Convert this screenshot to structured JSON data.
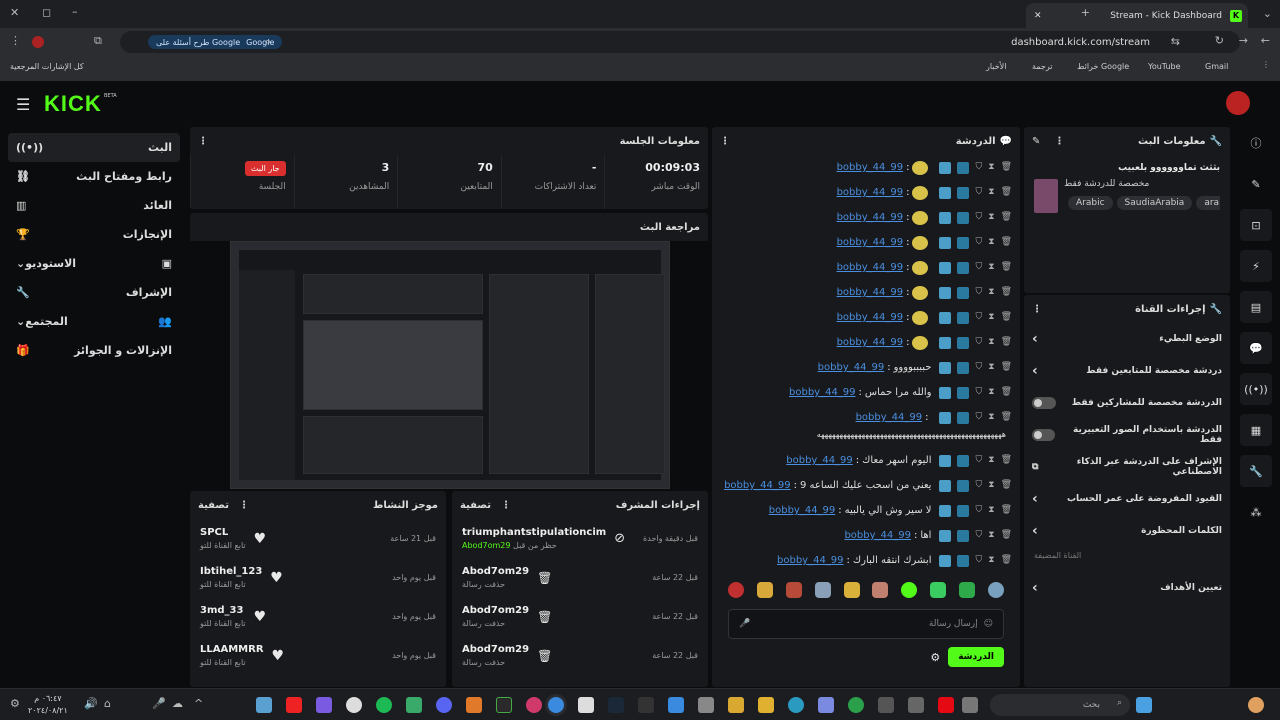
{
  "browser": {
    "tab_title": "Stream - Kick Dashboard",
    "tab_favicon": "K",
    "url": "dashboard.kick.com/stream",
    "google_pill": "طرح أسئلة على Google",
    "bookmarks": [
      "Gmail",
      "YouTube",
      "خرائط Google",
      "ترجمة",
      "الأخبار"
    ],
    "all_bookmarks": "كل الإشارات المرجعية"
  },
  "app": {
    "logo": "KICK",
    "logo_sup": "BETA",
    "accent": "#53fc18",
    "nav": [
      {
        "label": "البث",
        "icon": "broadcast-icon",
        "active": true
      },
      {
        "label": "رابط ومفتاح البث",
        "icon": "link-icon"
      },
      {
        "label": "العائد",
        "icon": "chart-icon"
      },
      {
        "label": "الإنجازات",
        "icon": "trophy-icon"
      },
      {
        "label": "الاستوديو",
        "icon": "studio-icon",
        "chevron": true
      },
      {
        "label": "الإشراف",
        "icon": "wrench-icon"
      },
      {
        "label": "المجتمع",
        "icon": "users-icon",
        "chevron": true
      },
      {
        "label": "الإنزالات و الجوائز",
        "icon": "gift-icon"
      }
    ]
  },
  "session": {
    "title": "معلومات الجلسة",
    "stats": [
      {
        "value": "00:09:03",
        "label": "الوقت مباشر"
      },
      {
        "value": "-",
        "label": "تعداد الاشتراكات"
      },
      {
        "value": "70",
        "label": "المتابعين"
      },
      {
        "value": "3",
        "label": "المشاهدين"
      },
      {
        "value": "جار البث",
        "label": "الجلسة"
      }
    ]
  },
  "preview": {
    "title": "مراجعة البث"
  },
  "activity": {
    "title": "موجز النشاط",
    "filter": "تصفية",
    "items": [
      {
        "name": "SPCL",
        "sub": "تابع القناة للتو",
        "when": "قبل 21 ساعة"
      },
      {
        "name": "Ibtihel_123",
        "sub": "تابع القناة للتو",
        "when": "قبل يوم واحد"
      },
      {
        "name": "3md_33",
        "sub": "تابع القناة للتو",
        "when": "قبل يوم واحد"
      },
      {
        "name": "LLAAMMRR",
        "sub": "تابع القناة للتو",
        "when": "قبل يوم واحد"
      }
    ]
  },
  "modactions": {
    "title": "إجراءات المشرف",
    "filter": "تصفية",
    "items": [
      {
        "name": "triumphantstipulationcim",
        "sub": "حظر من قبل",
        "by": "Abod7om29",
        "when": "قبل دقيقة واحدة",
        "icon": "ban-icon"
      },
      {
        "name": "Abod7om29",
        "sub": "حذفت رسالة",
        "when": "قبل 22 ساعة",
        "icon": "trash-icon"
      },
      {
        "name": "Abod7om29",
        "sub": "حذفت رسالة",
        "when": "قبل 22 ساعة",
        "icon": "trash-icon"
      },
      {
        "name": "Abod7om29",
        "sub": "حذفت رسالة",
        "when": "قبل 22 ساعة",
        "icon": "trash-icon"
      }
    ]
  },
  "chat": {
    "title": "الدردشة",
    "rows": [
      {
        "user": "bobby_44_99",
        "msg": "",
        "emoji": true
      },
      {
        "user": "bobby_44_99",
        "msg": "",
        "emoji": true
      },
      {
        "user": "bobby_44_99",
        "msg": "",
        "emoji": true
      },
      {
        "user": "bobby_44_99",
        "msg": "",
        "emoji": true
      },
      {
        "user": "bobby_44_99",
        "msg": "",
        "emoji": true
      },
      {
        "user": "bobby_44_99",
        "msg": "",
        "emoji": true
      },
      {
        "user": "bobby_44_99",
        "msg": "",
        "emoji": true
      },
      {
        "user": "bobby_44_99",
        "msg": "",
        "emoji": true
      },
      {
        "user": "bobby_44_99",
        "msg": "حببببوووو",
        "emoji": false
      },
      {
        "user": "bobby_44_99",
        "msg": "والله مرا حماس",
        "emoji": false
      },
      {
        "user": "bobby_44_99",
        "msg": "",
        "emoji": false
      }
    ],
    "long_line": "ههههههههههههههههههههههههههههههههههههههههههههههههههه",
    "rows2": [
      {
        "user": "bobby_44_99",
        "msg": "اليوم اسهر معاك"
      },
      {
        "user": "bobby_44_99",
        "msg": "يعني من اسحب عليك الساعه 9"
      },
      {
        "user": "bobby_44_99",
        "msg": "لا سير وش الي يالبيه"
      },
      {
        "user": "bobby_44_99",
        "msg": "اها"
      },
      {
        "user": "bobby_44_99",
        "msg": "ابشرك انتقه البارك"
      }
    ],
    "placeholder": "إرسال رسالة",
    "send": "الدردشة"
  },
  "streaminfo": {
    "title": "معلومات البث",
    "stream_title": "بثثث تماوووووو بلعبيب",
    "category": "مخصصة للدردشة فقط",
    "tags": [
      "Arabic",
      "SaudiaArabia",
      "ara"
    ]
  },
  "channel_actions": {
    "title": "إجراءات القناة",
    "rows": [
      {
        "label": "الوضع البطيء",
        "kind": "chevron"
      },
      {
        "label": "دردشة مخصصة للمتابعين فقط",
        "kind": "chevron"
      },
      {
        "label": "الدردشة مخصصة للمشاركين فقط",
        "kind": "toggle"
      },
      {
        "label": "الدردشة باستخدام الصور التعبيرية فقط",
        "kind": "toggle"
      },
      {
        "label": "الإشراف على الدردشة عبر الذكاء الاصطناعي",
        "kind": "external"
      },
      {
        "label": "القيود المفروضة على عمر الحساب",
        "kind": "chevron"
      },
      {
        "label": "الكلمات المحظورة",
        "kind": "chevron"
      }
    ],
    "section": "القناة المضيفة",
    "goals": "تعيين الأهداف"
  },
  "taskbar": {
    "search": "بحث",
    "time": "٠٦:٤٧ م",
    "date": "٢٠٢٤/٠٨/٢١"
  }
}
